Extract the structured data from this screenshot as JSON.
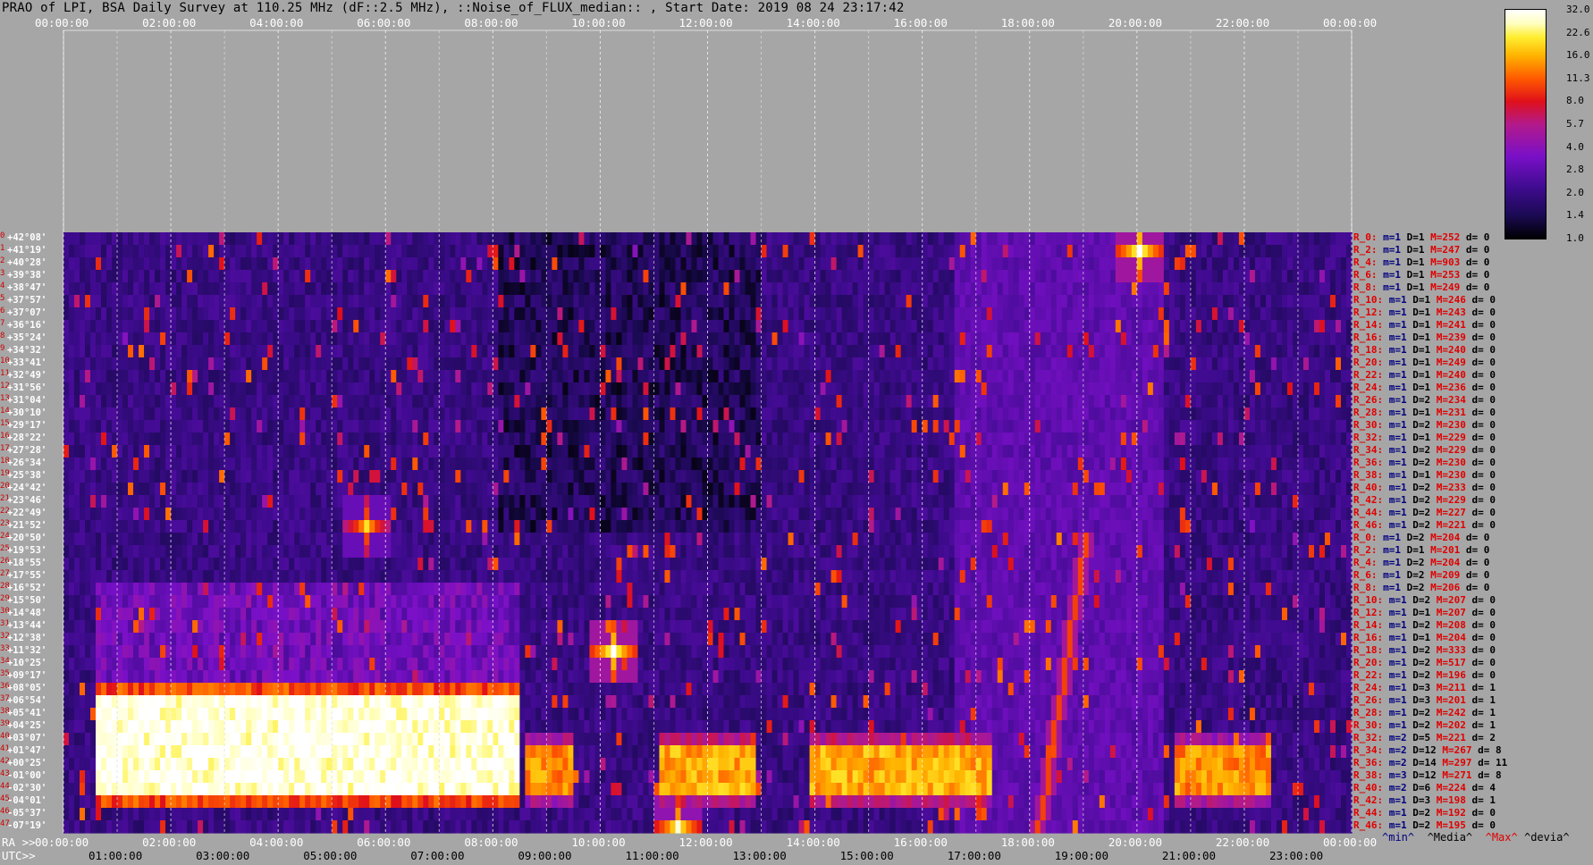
{
  "title": "PRAO of LPI, BSA Daily Survey at 110.25 MHz (dF::2.5 MHz), ::Noise_of_FLUX_median:: , Start Date: 2019 08 24 23:17:42",
  "top_axis_labels": [
    "00:00:00",
    "02:00:00",
    "04:00:00",
    "06:00:00",
    "08:00:00",
    "10:00:00",
    "12:00:00",
    "14:00:00",
    "16:00:00",
    "18:00:00",
    "20:00:00",
    "22:00:00",
    "00:00:00"
  ],
  "ra_axis": {
    "prefix": "RA >>",
    "labels": [
      "00:00:00",
      "02:00:00",
      "04:00:00",
      "06:00:00",
      "08:00:00",
      "10:00:00",
      "12:00:00",
      "14:00:00",
      "16:00:00",
      "18:00:00",
      "20:00:00",
      "22:00:00",
      "00:00:00"
    ]
  },
  "utc_axis": {
    "prefix": "UTC>>",
    "labels": [
      "01:00:00",
      "03:00:00",
      "05:00:00",
      "07:00:00",
      "09:00:00",
      "11:00:00",
      "13:00:00",
      "15:00:00",
      "17:00:00",
      "19:00:00",
      "21:00:00",
      "23:00:00"
    ]
  },
  "colorbar": {
    "labels": [
      "32.0",
      "22.6",
      "16.0",
      "11.3",
      "8.0",
      "5.7",
      "4.0",
      "2.8",
      "2.0",
      "1.4",
      "1.0"
    ]
  },
  "declinations": [
    "+42°08'",
    "+41°19'",
    "+40°28'",
    "+39°38'",
    "+38°47'",
    "+37°57'",
    "+37°07'",
    "+36°16'",
    "+35°24'",
    "+34°32'",
    "+33°41'",
    "+32°49'",
    "+31°56'",
    "+31°04'",
    "+30°10'",
    "+29°17'",
    "+28°22'",
    "+27°28'",
    "+26°34'",
    "+25°38'",
    "+24°42'",
    "+23°46'",
    "+22°49'",
    "+21°52'",
    "+20°50'",
    "+19°53'",
    "+18°55'",
    "+17°55'",
    "+16°52'",
    "+15°50'",
    "+14°48'",
    "+13°44'",
    "+12°38'",
    "+11°32'",
    "+10°25'",
    "+09°17'",
    "+08°05'",
    "+06°54'",
    "+05°41'",
    "+04°25'",
    "+03°07'",
    "+01°47'",
    "+00°25'",
    "-01°00'",
    "-02°30'",
    "-04°01'",
    "-05°37'",
    "-07°19'"
  ],
  "row_stats": [
    {
      "r": "R_0:",
      "m": "m=1",
      "D": "D=1",
      "M": "M=252",
      "d": "d= 0"
    },
    {
      "r": "R_2:",
      "m": "m=1",
      "D": "D=1",
      "M": "M=247",
      "d": "d= 0"
    },
    {
      "r": "R_4:",
      "m": "m=1",
      "D": "D=1",
      "M": "M=903",
      "d": "d= 0"
    },
    {
      "r": "R_6:",
      "m": "m=1",
      "D": "D=1",
      "M": "M=253",
      "d": "d= 0"
    },
    {
      "r": "R_8:",
      "m": "m=1",
      "D": "D=1",
      "M": "M=249",
      "d": "d= 0"
    },
    {
      "r": "R_10:",
      "m": "m=1",
      "D": "D=1",
      "M": "M=246",
      "d": "d= 0"
    },
    {
      "r": "R_12:",
      "m": "m=1",
      "D": "D=1",
      "M": "M=243",
      "d": "d= 0"
    },
    {
      "r": "R_14:",
      "m": "m=1",
      "D": "D=1",
      "M": "M=241",
      "d": "d= 0"
    },
    {
      "r": "R_16:",
      "m": "m=1",
      "D": "D=1",
      "M": "M=239",
      "d": "d= 0"
    },
    {
      "r": "R_18:",
      "m": "m=1",
      "D": "D=1",
      "M": "M=240",
      "d": "d= 0"
    },
    {
      "r": "R_20:",
      "m": "m=1",
      "D": "D=1",
      "M": "M=249",
      "d": "d= 0"
    },
    {
      "r": "R_22:",
      "m": "m=1",
      "D": "D=1",
      "M": "M=240",
      "d": "d= 0"
    },
    {
      "r": "R_24:",
      "m": "m=1",
      "D": "D=1",
      "M": "M=236",
      "d": "d= 0"
    },
    {
      "r": "R_26:",
      "m": "m=1",
      "D": "D=2",
      "M": "M=234",
      "d": "d= 0"
    },
    {
      "r": "R_28:",
      "m": "m=1",
      "D": "D=1",
      "M": "M=231",
      "d": "d= 0"
    },
    {
      "r": "R_30:",
      "m": "m=1",
      "D": "D=2",
      "M": "M=230",
      "d": "d= 0"
    },
    {
      "r": "R_32:",
      "m": "m=1",
      "D": "D=1",
      "M": "M=229",
      "d": "d= 0"
    },
    {
      "r": "R_34:",
      "m": "m=1",
      "D": "D=2",
      "M": "M=229",
      "d": "d= 0"
    },
    {
      "r": "R_36:",
      "m": "m=1",
      "D": "D=2",
      "M": "M=230",
      "d": "d= 0"
    },
    {
      "r": "R_38:",
      "m": "m=1",
      "D": "D=1",
      "M": "M=230",
      "d": "d= 0"
    },
    {
      "r": "R_40:",
      "m": "m=1",
      "D": "D=2",
      "M": "M=233",
      "d": "d= 0"
    },
    {
      "r": "R_42:",
      "m": "m=1",
      "D": "D=2",
      "M": "M=229",
      "d": "d= 0"
    },
    {
      "r": "R_44:",
      "m": "m=1",
      "D": "D=2",
      "M": "M=227",
      "d": "d= 0"
    },
    {
      "r": "R_46:",
      "m": "m=1",
      "D": "D=2",
      "M": "M=221",
      "d": "d= 0"
    },
    {
      "r": "R_0:",
      "m": "m=1",
      "D": "D=2",
      "M": "M=204",
      "d": "d= 0"
    },
    {
      "r": "R_2:",
      "m": "m=1",
      "D": "D=1",
      "M": "M=201",
      "d": "d= 0"
    },
    {
      "r": "R_4:",
      "m": "m=1",
      "D": "D=2",
      "M": "M=204",
      "d": "d= 0"
    },
    {
      "r": "R_6:",
      "m": "m=1",
      "D": "D=2",
      "M": "M=209",
      "d": "d= 0"
    },
    {
      "r": "R_8:",
      "m": "m=1",
      "D": "D=2",
      "M": "M=206",
      "d": "d= 0"
    },
    {
      "r": "R_10:",
      "m": "m=1",
      "D": "D=2",
      "M": "M=207",
      "d": "d= 0"
    },
    {
      "r": "R_12:",
      "m": "m=1",
      "D": "D=1",
      "M": "M=207",
      "d": "d= 0"
    },
    {
      "r": "R_14:",
      "m": "m=1",
      "D": "D=2",
      "M": "M=208",
      "d": "d= 0"
    },
    {
      "r": "R_16:",
      "m": "m=1",
      "D": "D=1",
      "M": "M=204",
      "d": "d= 0"
    },
    {
      "r": "R_18:",
      "m": "m=1",
      "D": "D=2",
      "M": "M=333",
      "d": "d= 0"
    },
    {
      "r": "R_20:",
      "m": "m=1",
      "D": "D=2",
      "M": "M=517",
      "d": "d= 0"
    },
    {
      "r": "R_22:",
      "m": "m=1",
      "D": "D=2",
      "M": "M=196",
      "d": "d= 0"
    },
    {
      "r": "R_24:",
      "m": "m=1",
      "D": "D=3",
      "M": "M=211",
      "d": "d= 1"
    },
    {
      "r": "R_26:",
      "m": "m=1",
      "D": "D=3",
      "M": "M=201",
      "d": "d= 1"
    },
    {
      "r": "R_28:",
      "m": "m=1",
      "D": "D=2",
      "M": "M=242",
      "d": "d= 1"
    },
    {
      "r": "R_30:",
      "m": "m=1",
      "D": "D=2",
      "M": "M=202",
      "d": "d= 1"
    },
    {
      "r": "R_32:",
      "m": "m=2",
      "D": "D=5",
      "M": "M=221",
      "d": "d= 2"
    },
    {
      "r": "R_34:",
      "m": "m=2",
      "D": "D=12",
      "M": "M=267",
      "d": "d= 8"
    },
    {
      "r": "R_36:",
      "m": "m=2",
      "D": "D=14",
      "M": "M=297",
      "d": "d= 11"
    },
    {
      "r": "R_38:",
      "m": "m=3",
      "D": "D=12",
      "M": "M=271",
      "d": "d= 8"
    },
    {
      "r": "R_40:",
      "m": "m=2",
      "D": "D=6",
      "M": "M=224",
      "d": "d= 4"
    },
    {
      "r": "R_42:",
      "m": "m=1",
      "D": "D=3",
      "M": "M=198",
      "d": "d= 1"
    },
    {
      "r": "R_44:",
      "m": "m=1",
      "D": "D=2",
      "M": "M=192",
      "d": "d= 0"
    },
    {
      "r": "R_46:",
      "m": "m=1",
      "D": "D=2",
      "M": "M=195",
      "d": "d= 0"
    }
  ],
  "legend": {
    "min": "^min^",
    "median": "^Media^",
    "max": "^Max^",
    "dev": "^devia^"
  },
  "colors": {
    "background": "#a6a6a6",
    "label_red": "#e00000",
    "label_blue": "#000080",
    "row_max": "#e00000"
  },
  "chart_data": {
    "type": "heatmap",
    "title": "PRAO of LPI, BSA Daily Survey at 110.25 MHz (dF::2.5 MHz), ::Noise_of_FLUX_median:: , Start Date: 2019 08 24 23:17:42",
    "x_axis": "RA / UTC hours",
    "x_range": [
      0,
      24
    ],
    "y_axis": "Declination",
    "y_categories": "declinations",
    "colorscale": [
      1.0,
      32.0
    ],
    "features": [
      {
        "kind": "bright_band",
        "rows": [
          36,
          45
        ],
        "ra_start": 0.6,
        "ra_end": 8.4,
        "level": 30
      },
      {
        "kind": "bright_band",
        "rows": [
          40,
          45
        ],
        "ra_start": 8.6,
        "ra_end": 9.4,
        "level": 14
      },
      {
        "kind": "bright_band",
        "rows": [
          40,
          45
        ],
        "ra_start": 11.1,
        "ra_end": 12.8,
        "level": 16
      },
      {
        "kind": "bright_band",
        "rows": [
          40,
          45
        ],
        "ra_start": 13.8,
        "ra_end": 17.2,
        "level": 16
      },
      {
        "kind": "bright_band",
        "rows": [
          40,
          45
        ],
        "ra_start": 20.6,
        "ra_end": 22.4,
        "level": 14
      },
      {
        "kind": "medium_band",
        "rows": [
          28,
          35
        ],
        "ra_start": 0.6,
        "ra_end": 8.4,
        "level": 3
      },
      {
        "kind": "diagonal_feature",
        "ra_start": 19.0,
        "ra_end": 18.1,
        "level": 10
      },
      {
        "kind": "point_source",
        "row": 1,
        "ra": 20.0,
        "level": 32
      },
      {
        "kind": "point_source",
        "row": 33,
        "ra": 10.2,
        "level": 32
      },
      {
        "kind": "point_source",
        "row": 23,
        "ra": 5.6,
        "level": 20
      },
      {
        "kind": "point_source",
        "row": 47,
        "ra": 11.4,
        "level": 28
      }
    ]
  }
}
